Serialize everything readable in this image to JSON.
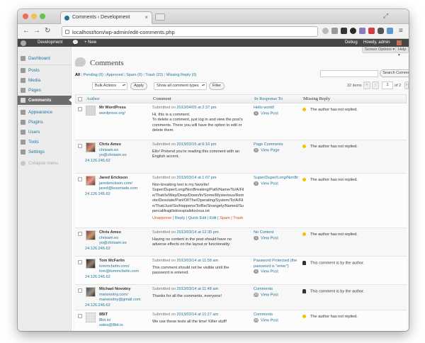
{
  "browser": {
    "tab_title": "Comments ‹ Development",
    "url": "localhost/tom/wp-admin/edit-comments.php",
    "colors": {
      "close": "#ed6a5e",
      "minimize": "#f4bf4f",
      "zoom": "#61c554"
    }
  },
  "admin_bar": {
    "site_name": "Development",
    "new_label": "+ New",
    "debug_label": "Debug",
    "howdy": "Howdy, admin"
  },
  "menu": {
    "dashboard": "Dashboard",
    "posts": "Posts",
    "media": "Media",
    "pages": "Pages",
    "comments": "Comments",
    "appearance": "Appearance",
    "plugins": "Plugins",
    "users": "Users",
    "tools": "Tools",
    "settings": "Settings",
    "collapse": "Collapse menu"
  },
  "screen_options": "Screen Options ▾",
  "help": "Help ▾",
  "page_title": "Comments",
  "filters": {
    "all": "All",
    "pending": "Pending (0)",
    "approved": "Approved",
    "spam": "Spam (0)",
    "trash": "Trash (22)",
    "missing_reply": "Missing Reply (0)"
  },
  "search_button": "Search Comments",
  "bulk_actions": "Bulk Actions",
  "apply": "Apply",
  "comment_types": "Show all comment types",
  "filter": "Filter",
  "pagination": {
    "items": "32 items",
    "first": "«",
    "prev": "‹",
    "current_page": "1",
    "of": "of 2",
    "next": "›",
    "last": "»"
  },
  "columns": {
    "author": "Author",
    "comment": "Comment",
    "in_response_to": "In Response To",
    "missing_reply": "Missing Reply"
  },
  "rows": [
    {
      "author": "Mr WordPress",
      "url": "wordpress.org/",
      "email": "",
      "ip": "",
      "submitted_prefix": "Submitted on ",
      "date": "2013/04/05 at 2:37 pm",
      "text": "Hi, this is a comment.\nTo delete a comment, just log in and view the post's comments. There you will have the option to edit or delete them.",
      "response_title": "Hello world!",
      "count": "1",
      "view": "View Post",
      "reply": "The author has not replied."
    },
    {
      "author": "Chris Ames",
      "url": "chrisam.es",
      "email": "yo@chrisam.es",
      "ip": "24.126.245.62",
      "submitted_prefix": "Submitted on ",
      "date": "2013/03/15 at 6:16 pm",
      "text": "Ello! Pretend you're reading this comment with an English accent.",
      "response_title": "Page Comments",
      "count": "0",
      "view": "View Page",
      "reply": "The author has not replied."
    },
    {
      "author": "Jared Erickson",
      "url": "jarederickson.com/",
      "email": "jared@lessmade.com",
      "ip": "24.126.245.62",
      "submitted_prefix": "Submitted on ",
      "date": "2013/03/14 at 1:07 pm",
      "text": "Non-breaking text is my favorite!\nSuper/Duper/Long/NonBreaking/Path/Name/To/A/File/That/Is/Way/Deep/Down/In/Some/Mysterious/Remote/Desolate/Part/Of/The/Operating/System/To/A/File/That/Just/So/Happens/To/Be/Strangely/Named/Supercalifragilisticexpialidocious.txt",
      "actions": {
        "unapprove": "Unapprove",
        "rest": " | Reply | Quick Edit | Edit | ",
        "spam_trash": "Spam | Trash"
      },
      "response_title": "Super/Duper/Long/NonBr",
      "count": "1",
      "view": "View Post",
      "reply": "The author has not replied."
    },
    {
      "author": "Chris Ames",
      "url": "chrisam.es",
      "email": "yo@chrisam.es",
      "ip": "24.126.245.62",
      "submitted_prefix": "Submitted on ",
      "date": "2013/03/14 at 12:35 pm",
      "text": "Having no content in the post should have no adverse effects on the layout or functionality.",
      "response_title": "No Content",
      "count": "1",
      "view": "View Post",
      "reply": "The author has not replied."
    },
    {
      "author": "Tom McFarlin",
      "url": "tommcfarlin.com/",
      "email": "tom@tommcfarlin.com",
      "ip": "24.126.245.62",
      "submitted_prefix": "Submitted on ",
      "date": "2013/03/14 at 11:58 am",
      "text": "This comment should not be visible until the password is entered.",
      "response_title": "Password Protected (the password is \"enter\")",
      "count": "1",
      "view": "View Post",
      "reply": "This comment is by the author."
    },
    {
      "author": "Michael Novotny",
      "url": "manovotny.com/",
      "email": "manovotny@gmail.com",
      "ip": "24.126.245.62",
      "submitted_prefix": "Submitted on ",
      "date": "2013/03/14 at 11:48 am",
      "text": "Thanks for all the comments, everyone!",
      "response_title": "Comments",
      "count": "20",
      "view": "View Post",
      "reply": "This comment is by the author."
    },
    {
      "author": "8BIT",
      "url": "8bit.io/",
      "email": "sales@8bit.io",
      "ip": "24.126.245.62",
      "submitted_prefix": "Submitted on ",
      "date": "2013/03/14 at 11:27 am",
      "text": "We use these tests all the time! Killer stuff!",
      "response_title": "Comments",
      "count": "20",
      "view": "View Post",
      "reply": "The author has not replied."
    }
  ]
}
